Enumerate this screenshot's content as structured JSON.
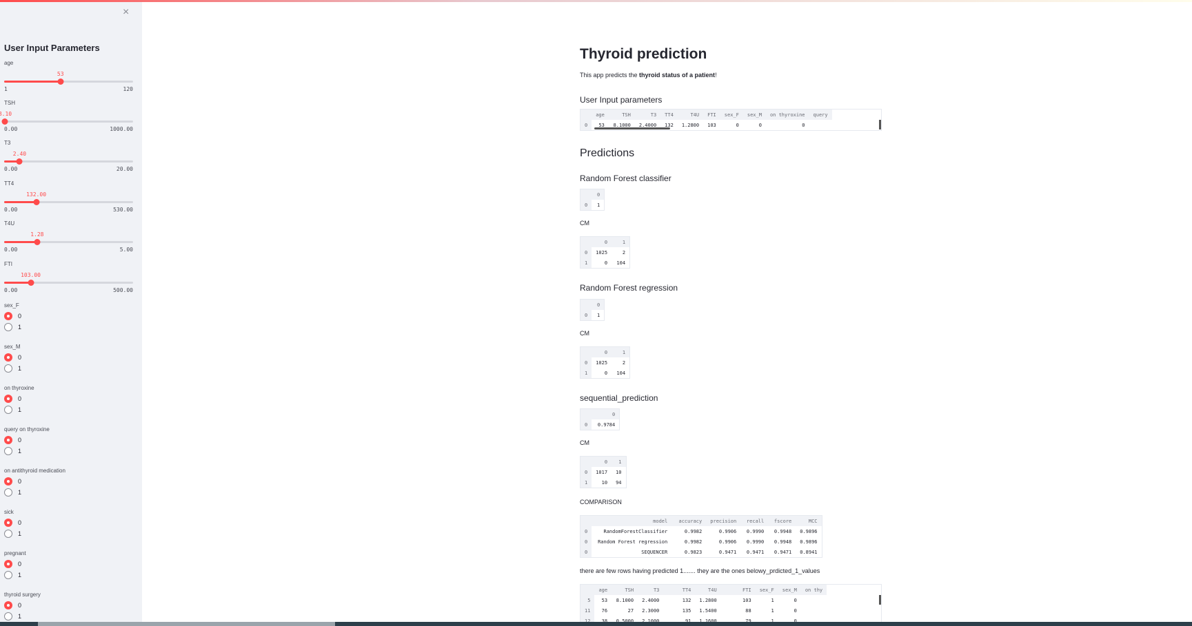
{
  "sidebar": {
    "close_glyph": "×",
    "title": "User Input Parameters",
    "sliders": [
      {
        "label": "age",
        "value": "53",
        "min": "1",
        "max": "120",
        "fraction": 0.437
      },
      {
        "label": "TSH",
        "value": "8.10",
        "min": "0.00",
        "max": "1000.00",
        "fraction": 0.008
      },
      {
        "label": "T3",
        "value": "2.40",
        "min": "0.00",
        "max": "20.00",
        "fraction": 0.12
      },
      {
        "label": "TT4",
        "value": "132.00",
        "min": "0.00",
        "max": "530.00",
        "fraction": 0.249
      },
      {
        "label": "T4U",
        "value": "1.28",
        "min": "0.00",
        "max": "5.00",
        "fraction": 0.256
      },
      {
        "label": "FTI",
        "value": "103.00",
        "min": "0.00",
        "max": "500.00",
        "fraction": 0.206
      }
    ],
    "radios": [
      {
        "label": "sex_F",
        "options": [
          "0",
          "1"
        ],
        "selected": "0"
      },
      {
        "label": "sex_M",
        "options": [
          "0",
          "1"
        ],
        "selected": "0"
      },
      {
        "label": "on thyroxine",
        "options": [
          "0",
          "1"
        ],
        "selected": "0"
      },
      {
        "label": "query on thyroxine",
        "options": [
          "0",
          "1"
        ],
        "selected": "0"
      },
      {
        "label": "on antithyroid medication",
        "options": [
          "0",
          "1"
        ],
        "selected": "0"
      },
      {
        "label": "sick",
        "options": [
          "0",
          "1"
        ],
        "selected": "0"
      },
      {
        "label": "pregnant",
        "options": [
          "0",
          "1"
        ],
        "selected": "0"
      },
      {
        "label": "thyroid surgery",
        "options": [
          "0",
          "1"
        ],
        "selected": "0"
      }
    ]
  },
  "main": {
    "title": "Thyroid prediction",
    "intro": {
      "before": "This app predicts the ",
      "bold": "thyroid status of a patient",
      "after": "!"
    },
    "user_input_heading": "User Input parameters",
    "user_input_table": {
      "columns": [
        "",
        "age",
        "TSH",
        "T3",
        "TT4",
        "T4U",
        "FTI",
        "sex_F",
        "sex_M",
        "on thyroxine",
        "query"
      ],
      "rows": [
        [
          "0",
          "53",
          "8.1000",
          "2.4000",
          "132",
          "1.2800",
          "103",
          "0",
          "0",
          "0",
          ""
        ]
      ]
    },
    "predictions_heading": "Predictions",
    "rf_classifier": {
      "heading": "Random Forest classifier",
      "pred": {
        "columns": [
          "",
          "0"
        ],
        "rows": [
          [
            "0",
            "1"
          ]
        ]
      },
      "cm_label": "CM",
      "cm": {
        "columns": [
          "",
          "0",
          "1"
        ],
        "rows": [
          [
            "0",
            "1025",
            "2"
          ],
          [
            "1",
            "0",
            "104"
          ]
        ]
      }
    },
    "rf_regression": {
      "heading": "Random Forest regression",
      "pred": {
        "columns": [
          "",
          "0"
        ],
        "rows": [
          [
            "0",
            "1"
          ]
        ]
      },
      "cm_label": "CM",
      "cm": {
        "columns": [
          "",
          "0",
          "1"
        ],
        "rows": [
          [
            "0",
            "1025",
            "2"
          ],
          [
            "1",
            "0",
            "104"
          ]
        ]
      }
    },
    "sequential": {
      "heading": "sequential_prediction",
      "pred": {
        "columns": [
          "",
          "0"
        ],
        "rows": [
          [
            "0",
            "0.9784"
          ]
        ]
      },
      "cm_label": "CM",
      "cm": {
        "columns": [
          "",
          "0",
          "1"
        ],
        "rows": [
          [
            "0",
            "1017",
            "10"
          ],
          [
            "1",
            "10",
            "94"
          ]
        ]
      }
    },
    "comparison_label": "COMPARISON",
    "comparison": {
      "columns": [
        "",
        "model",
        "accuracy",
        "precision",
        "recall",
        "fscore",
        "MCC"
      ],
      "rows": [
        [
          "0",
          "RandomForestClassifier",
          "0.9982",
          "0.9906",
          "0.9990",
          "0.9948",
          "0.9896"
        ],
        [
          "0",
          "Random Forest regression",
          "0.9982",
          "0.9906",
          "0.9990",
          "0.9948",
          "0.9896"
        ],
        [
          "0",
          "SEQUENCER",
          "0.9823",
          "0.9471",
          "0.9471",
          "0.9471",
          "0.8941"
        ]
      ]
    },
    "few_rows_note": "there are few rows having predicted 1....... they are the ones belowy_prdicted_1_values",
    "predicted_1_table": {
      "columns": [
        "",
        "age",
        "TSH",
        "T3",
        "TT4",
        "T4U",
        "FTI",
        "sex_F",
        "sex_M",
        "on thy"
      ],
      "rows": [
        [
          "5",
          "53",
          "8.1000",
          "2.4000",
          "132",
          "1.2800",
          "103",
          "1",
          "0",
          ""
        ],
        [
          "11",
          "76",
          "27",
          "2.3000",
          "135",
          "1.5400",
          "88",
          "1",
          "0",
          ""
        ],
        [
          "12",
          "38",
          "0.5000",
          "2.1000",
          "91",
          "1.1600",
          "79",
          "1",
          "0",
          ""
        ]
      ]
    }
  }
}
